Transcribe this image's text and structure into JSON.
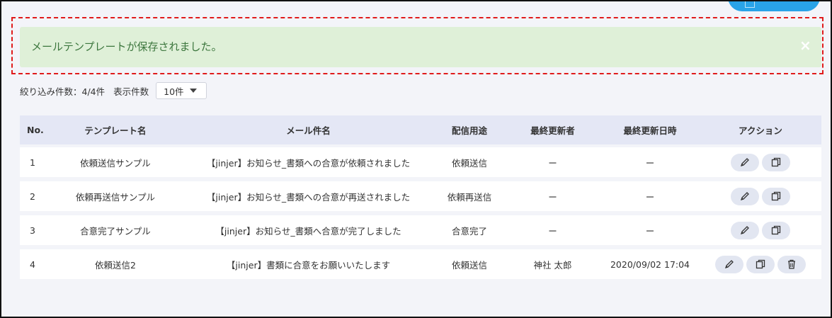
{
  "alert": {
    "message": "メールテンプレートが保存されました。",
    "close_label": "×"
  },
  "filter": {
    "count_label": "絞り込み件数：4/4件",
    "per_page_label": "表示件数",
    "per_page_value": "10件"
  },
  "table": {
    "headers": {
      "no": "No.",
      "name": "テンプレート名",
      "subject": "メール件名",
      "use": "配信用途",
      "updated_by": "最終更新者",
      "updated_at": "最終更新日時",
      "actions": "アクション"
    },
    "rows": [
      {
        "no": "1",
        "name": "依頼送信サンプル",
        "subject": "【jinjer】お知らせ_書類への合意が依頼されました",
        "use": "依頼送信",
        "updated_by": "ー",
        "updated_at": "ー"
      },
      {
        "no": "2",
        "name": "依頼再送信サンプル",
        "subject": "【jinjer】お知らせ_書類への合意が再送されました",
        "use": "依頼再送信",
        "updated_by": "ー",
        "updated_at": "ー"
      },
      {
        "no": "3",
        "name": "合意完了サンプル",
        "subject": "【jinjer】お知らせ_書類へ合意が完了しました",
        "use": "合意完了",
        "updated_by": "ー",
        "updated_at": "ー"
      },
      {
        "no": "4",
        "name": "依頼送信2",
        "subject": "【jinjer】書類に合意をお願いいたします",
        "use": "依頼送信",
        "updated_by": "神社 太郎",
        "updated_at": "2020/09/02 17:04"
      }
    ]
  },
  "icons": {
    "edit": "pencil-icon",
    "copy": "copy-icon",
    "delete": "trash-icon"
  },
  "colors": {
    "alert_bg": "#dff0d8",
    "alert_text": "#3c763d",
    "highlight_border": "#e01b1b",
    "header_bg": "#e4e7f5",
    "page_bg": "#f3f4f9",
    "action_btn_bg": "#e2e6f1",
    "primary_button": "#29a3e8"
  }
}
